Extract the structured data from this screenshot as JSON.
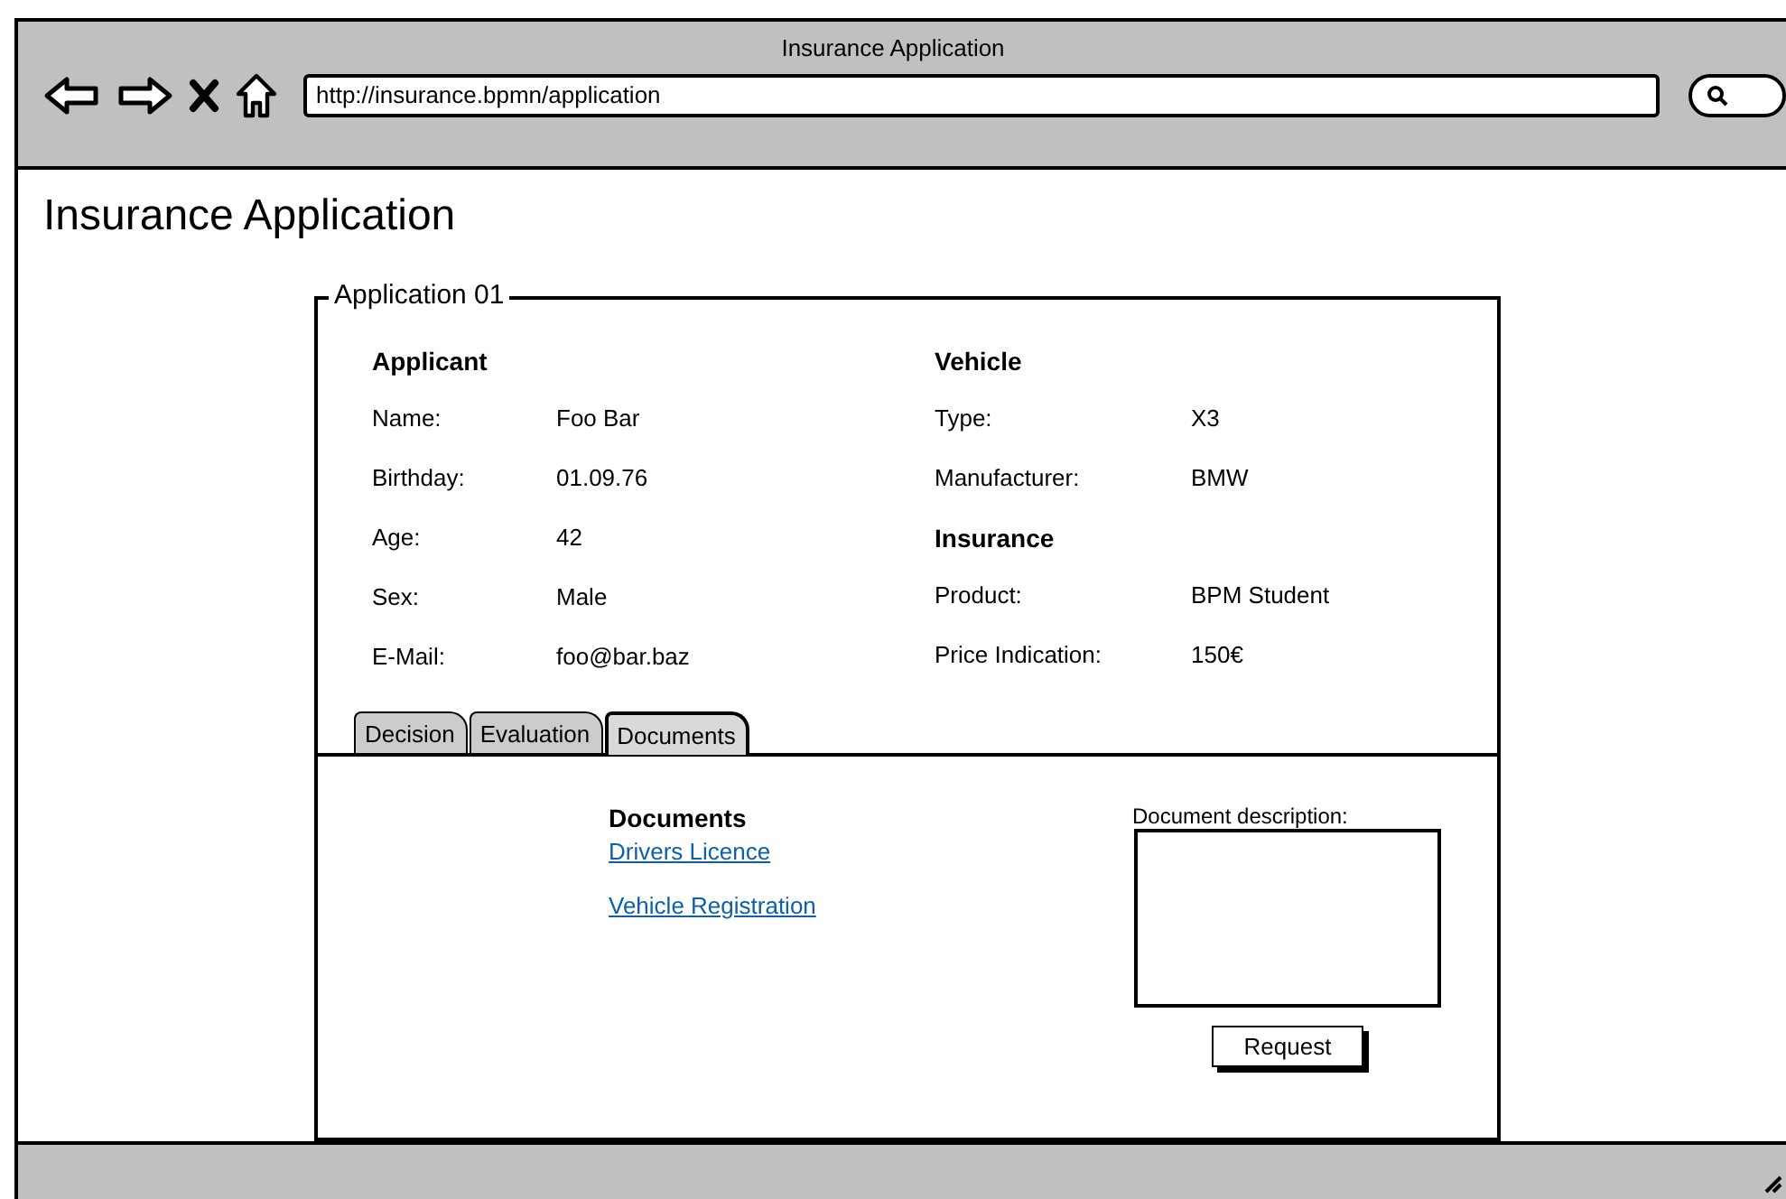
{
  "window": {
    "title": "Insurance Application",
    "url": "http://insurance.bpmn/application"
  },
  "page_title": "Insurance Application",
  "form": {
    "legend": "Application 01",
    "left": {
      "heading": "Applicant",
      "fields": [
        {
          "label": "Name:",
          "value": "Foo Bar"
        },
        {
          "label": "Birthday:",
          "value": "01.09.76"
        },
        {
          "label": "Age:",
          "value": "42"
        },
        {
          "label": "Sex:",
          "value": "Male"
        },
        {
          "label": "E-Mail:",
          "value": "foo@bar.baz"
        }
      ]
    },
    "right": [
      {
        "kind": "heading",
        "text": "Vehicle"
      },
      {
        "kind": "field",
        "label": "Type:",
        "value": "X3"
      },
      {
        "kind": "field",
        "label": "Manufacturer:",
        "value": "BMW"
      },
      {
        "kind": "heading",
        "text": "Insurance"
      },
      {
        "kind": "field",
        "label": "Product:",
        "value": "BPM Student"
      },
      {
        "kind": "field",
        "label": "Price Indication:",
        "value": "150€"
      }
    ],
    "tabs": [
      {
        "label": "Decision",
        "selected": false
      },
      {
        "label": "Evaluation",
        "selected": false
      },
      {
        "label": "Documents",
        "selected": true
      }
    ],
    "documents": {
      "heading": "Documents",
      "links": [
        "Drivers Licence",
        "Vehicle Registration"
      ],
      "description_label": "Document description:",
      "button": "Request"
    }
  }
}
